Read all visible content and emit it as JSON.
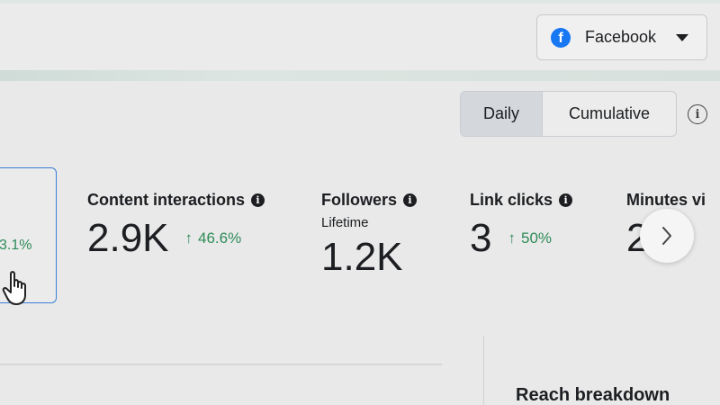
{
  "header": {
    "platform_select": {
      "label": "Facebook",
      "icon": "facebook-logo-icon",
      "brand_color": "#1877f2"
    }
  },
  "view_toggle": {
    "options": [
      "Daily",
      "Cumulative"
    ],
    "selected": "Daily"
  },
  "metrics": {
    "selected_card": {
      "change": "3.1%"
    },
    "content_interactions": {
      "title": "Content interactions",
      "value": "2.9K",
      "change": "46.6%"
    },
    "followers": {
      "title": "Followers",
      "subtitle": "Lifetime",
      "value": "1.2K"
    },
    "link_clicks": {
      "title": "Link clicks",
      "value": "3",
      "change": "50%"
    },
    "minutes_viewed": {
      "title": "Minutes vi",
      "value": "2 3"
    }
  },
  "colors": {
    "positive_change": "#2e8b57",
    "selected_border": "#3b7fd6"
  },
  "section": {
    "reach_heading": "Reach breakdown"
  }
}
